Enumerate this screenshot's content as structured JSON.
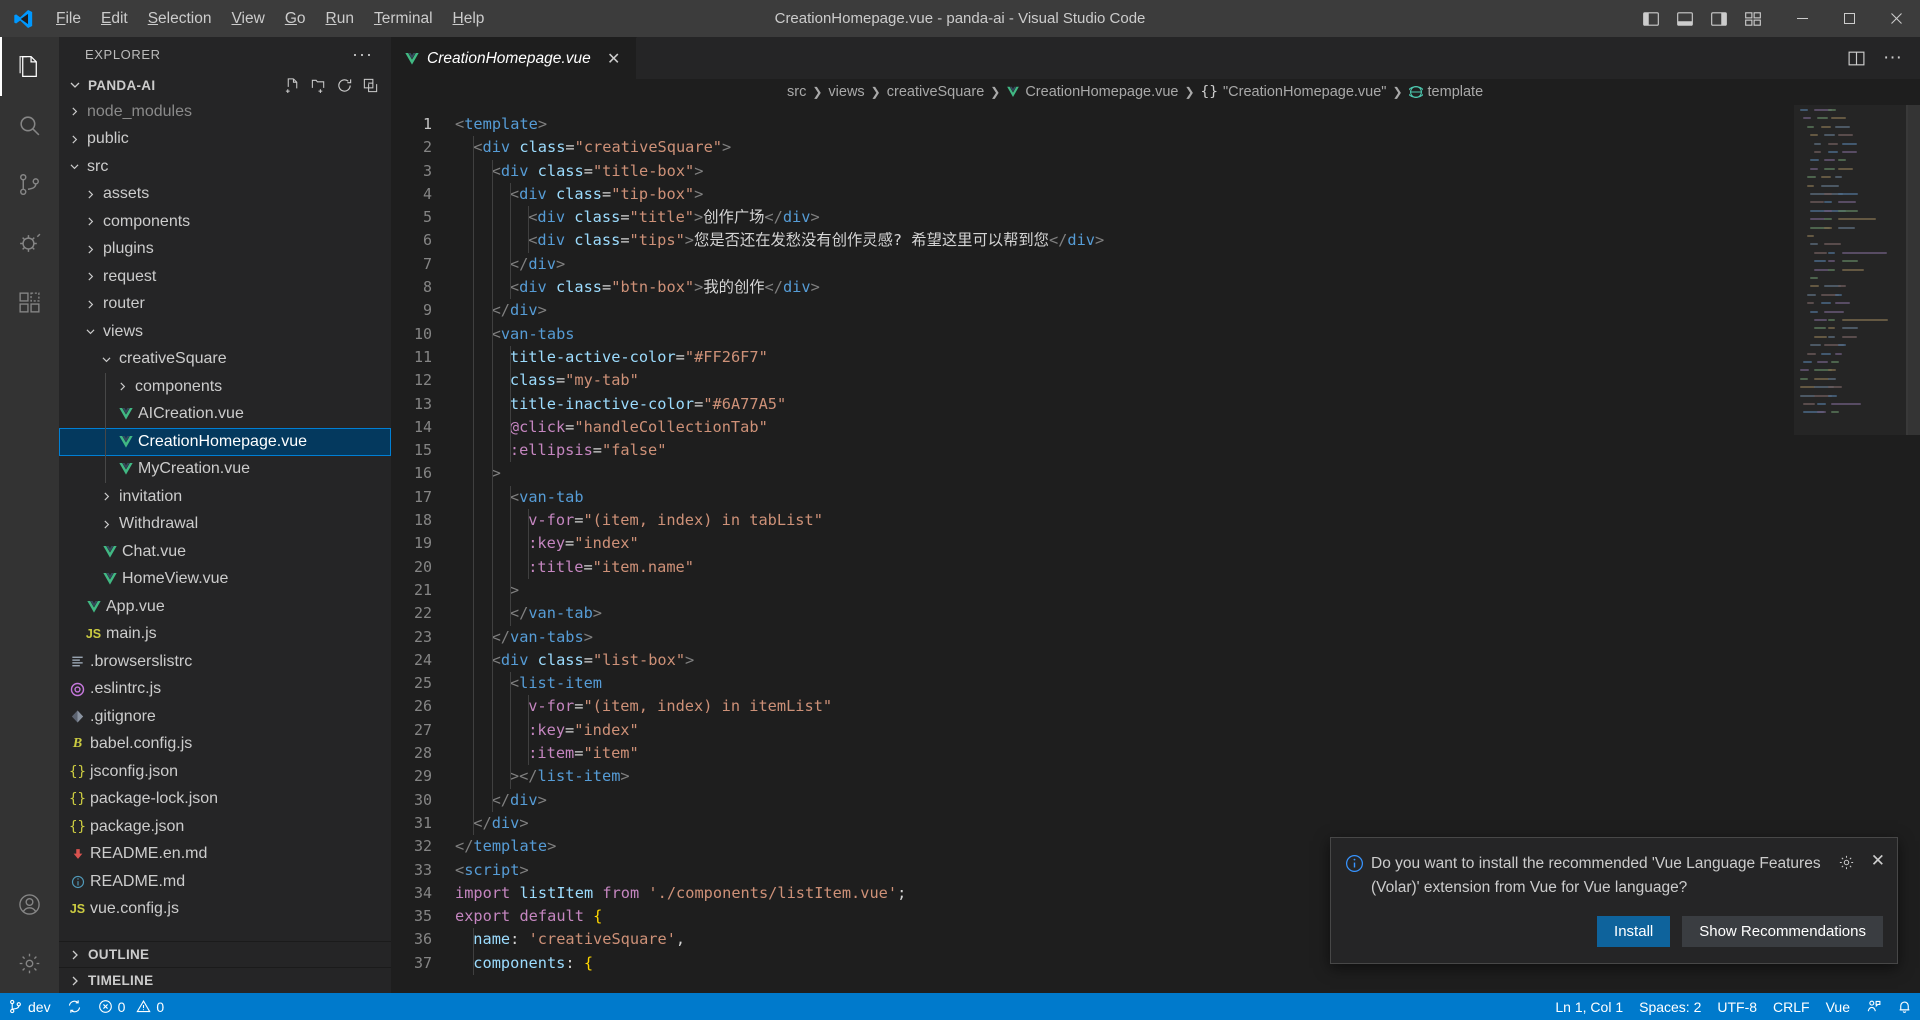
{
  "window": {
    "title": "CreationHomepage.vue - panda-ai - Visual Studio Code",
    "minimize": "─",
    "maximize": "□",
    "close": "✕"
  },
  "menu": {
    "items": [
      {
        "label": "File"
      },
      {
        "label": "Edit"
      },
      {
        "label": "Selection"
      },
      {
        "label": "View"
      },
      {
        "label": "Go"
      },
      {
        "label": "Run"
      },
      {
        "label": "Terminal"
      },
      {
        "label": "Help"
      }
    ]
  },
  "activitybar": {
    "items": [
      {
        "name": "explorer",
        "icon": "files-icon",
        "active": true
      },
      {
        "name": "search",
        "icon": "search-icon",
        "active": false
      },
      {
        "name": "source-control",
        "icon": "source-control-icon",
        "active": false
      },
      {
        "name": "run-debug",
        "icon": "run-and-debug-icon",
        "active": false
      },
      {
        "name": "extensions",
        "icon": "extensions-icon",
        "active": false
      }
    ],
    "bottom": [
      {
        "name": "accounts",
        "icon": "account-icon"
      },
      {
        "name": "settings",
        "icon": "gear-icon"
      }
    ]
  },
  "sidebar": {
    "header_title": "EXPLORER",
    "more_actions": "···",
    "project_name": "PANDA-AI",
    "project_actions": [
      "new-file-icon",
      "new-folder-icon",
      "refresh-icon",
      "collapse-all-icon"
    ],
    "tree": [
      {
        "label": "node_modules",
        "type": "folder",
        "expanded": false,
        "depth": 1,
        "dim": true
      },
      {
        "label": "public",
        "type": "folder",
        "expanded": false,
        "depth": 1
      },
      {
        "label": "src",
        "type": "folder",
        "expanded": true,
        "depth": 1
      },
      {
        "label": "assets",
        "type": "folder",
        "expanded": false,
        "depth": 2
      },
      {
        "label": "components",
        "type": "folder",
        "expanded": false,
        "depth": 2
      },
      {
        "label": "plugins",
        "type": "folder",
        "expanded": false,
        "depth": 2
      },
      {
        "label": "request",
        "type": "folder",
        "expanded": false,
        "depth": 2
      },
      {
        "label": "router",
        "type": "folder",
        "expanded": false,
        "depth": 2
      },
      {
        "label": "views",
        "type": "folder",
        "expanded": true,
        "depth": 2
      },
      {
        "label": "creativeSquare",
        "type": "folder",
        "expanded": true,
        "depth": 3
      },
      {
        "label": "components",
        "type": "folder",
        "expanded": false,
        "depth": 4
      },
      {
        "label": "AICreation.vue",
        "type": "vue",
        "depth": 4
      },
      {
        "label": "CreationHomepage.vue",
        "type": "vue",
        "depth": 4,
        "selected": true
      },
      {
        "label": "MyCreation.vue",
        "type": "vue",
        "depth": 4
      },
      {
        "label": "invitation",
        "type": "folder",
        "expanded": false,
        "depth": 3
      },
      {
        "label": "Withdrawal",
        "type": "folder",
        "expanded": false,
        "depth": 3
      },
      {
        "label": "Chat.vue",
        "type": "vue",
        "depth": 3
      },
      {
        "label": "HomeView.vue",
        "type": "vue",
        "depth": 3
      },
      {
        "label": "App.vue",
        "type": "vue",
        "depth": 2
      },
      {
        "label": "main.js",
        "type": "js",
        "depth": 2
      },
      {
        "label": ".browserslistrc",
        "type": "config",
        "depth": 1
      },
      {
        "label": ".eslintrc.js",
        "type": "eslint",
        "depth": 1
      },
      {
        "label": ".gitignore",
        "type": "git",
        "depth": 1
      },
      {
        "label": "babel.config.js",
        "type": "babel",
        "depth": 1
      },
      {
        "label": "jsconfig.json",
        "type": "json",
        "depth": 1
      },
      {
        "label": "package-lock.json",
        "type": "json",
        "depth": 1
      },
      {
        "label": "package.json",
        "type": "json",
        "depth": 1
      },
      {
        "label": "README.en.md",
        "type": "md-red",
        "depth": 1
      },
      {
        "label": "README.md",
        "type": "md-blue",
        "depth": 1
      },
      {
        "label": "vue.config.js",
        "type": "js",
        "depth": 1
      }
    ],
    "collapsed_sections": [
      {
        "label": "OUTLINE"
      },
      {
        "label": "TIMELINE"
      }
    ]
  },
  "editor": {
    "tab": {
      "name": "CreationHomepage.vue",
      "icon": "vue-icon",
      "close": "✕",
      "modified": false
    },
    "tab_actions": [
      "split-editor-icon",
      "more-actions-icon"
    ],
    "breadcrumb": [
      {
        "label": "src",
        "icon": ""
      },
      {
        "label": "views",
        "icon": ""
      },
      {
        "label": "creativeSquare",
        "icon": ""
      },
      {
        "label": "CreationHomepage.vue",
        "icon": "vue-icon"
      },
      {
        "label": "\"CreationHomepage.vue\"",
        "icon": "json-braces-icon"
      },
      {
        "label": "template",
        "icon": "symbol-module-icon"
      }
    ],
    "first_line": 1,
    "code_lines": [
      {
        "n": 1,
        "indent": 0,
        "tokens": [
          [
            "t-brk",
            "<"
          ],
          [
            "t-tag",
            "template"
          ],
          [
            "t-brk",
            ">"
          ]
        ]
      },
      {
        "n": 2,
        "indent": 1,
        "tokens": [
          [
            "t-brk",
            "<"
          ],
          [
            "t-tag",
            "div"
          ],
          [
            "t-attr",
            " class"
          ],
          [
            "t-punc",
            "="
          ],
          [
            "t-str",
            "\"creativeSquare\""
          ],
          [
            "t-brk",
            ">"
          ]
        ]
      },
      {
        "n": 3,
        "indent": 2,
        "tokens": [
          [
            "t-brk",
            "<"
          ],
          [
            "t-tag",
            "div"
          ],
          [
            "t-attr",
            " class"
          ],
          [
            "t-punc",
            "="
          ],
          [
            "t-str",
            "\"title-box\""
          ],
          [
            "t-brk",
            ">"
          ]
        ]
      },
      {
        "n": 4,
        "indent": 3,
        "tokens": [
          [
            "t-brk",
            "<"
          ],
          [
            "t-tag",
            "div"
          ],
          [
            "t-attr",
            " class"
          ],
          [
            "t-punc",
            "="
          ],
          [
            "t-str",
            "\"tip-box\""
          ],
          [
            "t-brk",
            ">"
          ]
        ]
      },
      {
        "n": 5,
        "indent": 4,
        "tokens": [
          [
            "t-brk",
            "<"
          ],
          [
            "t-tag",
            "div"
          ],
          [
            "t-attr",
            " class"
          ],
          [
            "t-punc",
            "="
          ],
          [
            "t-str",
            "\"title\""
          ],
          [
            "t-brk",
            ">"
          ],
          [
            "t-txt",
            "创作广场"
          ],
          [
            "t-brk",
            "</"
          ],
          [
            "t-tag",
            "div"
          ],
          [
            "t-brk",
            ">"
          ]
        ]
      },
      {
        "n": 6,
        "indent": 4,
        "tokens": [
          [
            "t-brk",
            "<"
          ],
          [
            "t-tag",
            "div"
          ],
          [
            "t-attr",
            " class"
          ],
          [
            "t-punc",
            "="
          ],
          [
            "t-str",
            "\"tips\""
          ],
          [
            "t-brk",
            ">"
          ],
          [
            "t-txt",
            "您是否还在发愁没有创作灵感? 希望这里可以帮到您"
          ],
          [
            "t-brk",
            "</"
          ],
          [
            "t-tag",
            "div"
          ],
          [
            "t-brk",
            ">"
          ]
        ]
      },
      {
        "n": 7,
        "indent": 3,
        "tokens": [
          [
            "t-brk",
            "</"
          ],
          [
            "t-tag",
            "div"
          ],
          [
            "t-brk",
            ">"
          ]
        ]
      },
      {
        "n": 8,
        "indent": 3,
        "tokens": [
          [
            "t-brk",
            "<"
          ],
          [
            "t-tag",
            "div"
          ],
          [
            "t-attr",
            " class"
          ],
          [
            "t-punc",
            "="
          ],
          [
            "t-str",
            "\"btn-box\""
          ],
          [
            "t-brk",
            ">"
          ],
          [
            "t-txt",
            "我的创作"
          ],
          [
            "t-brk",
            "</"
          ],
          [
            "t-tag",
            "div"
          ],
          [
            "t-brk",
            ">"
          ]
        ]
      },
      {
        "n": 9,
        "indent": 2,
        "tokens": [
          [
            "t-brk",
            "</"
          ],
          [
            "t-tag",
            "div"
          ],
          [
            "t-brk",
            ">"
          ]
        ]
      },
      {
        "n": 10,
        "indent": 2,
        "tokens": [
          [
            "t-brk",
            "<"
          ],
          [
            "t-tag",
            "van-tabs"
          ]
        ]
      },
      {
        "n": 11,
        "indent": 3,
        "tokens": [
          [
            "t-attr",
            "title-active-color"
          ],
          [
            "t-punc",
            "="
          ],
          [
            "t-str",
            "\"#FF26F7\""
          ]
        ]
      },
      {
        "n": 12,
        "indent": 3,
        "tokens": [
          [
            "t-attr",
            "class"
          ],
          [
            "t-punc",
            "="
          ],
          [
            "t-str",
            "\"my-tab\""
          ]
        ]
      },
      {
        "n": 13,
        "indent": 3,
        "tokens": [
          [
            "t-attr",
            "title-inactive-color"
          ],
          [
            "t-punc",
            "="
          ],
          [
            "t-str",
            "\"#6A77A5\""
          ]
        ]
      },
      {
        "n": 14,
        "indent": 3,
        "tokens": [
          [
            "t-kw",
            "@click"
          ],
          [
            "t-punc",
            "="
          ],
          [
            "t-str",
            "\"handleCollectionTab\""
          ]
        ]
      },
      {
        "n": 15,
        "indent": 3,
        "tokens": [
          [
            "t-kw",
            ":ellipsis"
          ],
          [
            "t-punc",
            "="
          ],
          [
            "t-str",
            "\"false\""
          ]
        ]
      },
      {
        "n": 16,
        "indent": 2,
        "tokens": [
          [
            "t-brk",
            ">"
          ]
        ]
      },
      {
        "n": 17,
        "indent": 3,
        "tokens": [
          [
            "t-brk",
            "<"
          ],
          [
            "t-tag",
            "van-tab"
          ]
        ]
      },
      {
        "n": 18,
        "indent": 4,
        "tokens": [
          [
            "t-kw",
            "v-for"
          ],
          [
            "t-punc",
            "="
          ],
          [
            "t-str",
            "\"(item, index) in tabList\""
          ]
        ]
      },
      {
        "n": 19,
        "indent": 4,
        "tokens": [
          [
            "t-kw",
            ":key"
          ],
          [
            "t-punc",
            "="
          ],
          [
            "t-str",
            "\"index\""
          ]
        ]
      },
      {
        "n": 20,
        "indent": 4,
        "tokens": [
          [
            "t-kw",
            ":title"
          ],
          [
            "t-punc",
            "="
          ],
          [
            "t-str",
            "\"item.name\""
          ]
        ]
      },
      {
        "n": 21,
        "indent": 3,
        "tokens": [
          [
            "t-brk",
            ">"
          ]
        ]
      },
      {
        "n": 22,
        "indent": 3,
        "tokens": [
          [
            "t-brk",
            "</"
          ],
          [
            "t-tag",
            "van-tab"
          ],
          [
            "t-brk",
            ">"
          ]
        ]
      },
      {
        "n": 23,
        "indent": 2,
        "tokens": [
          [
            "t-brk",
            "</"
          ],
          [
            "t-tag",
            "van-tabs"
          ],
          [
            "t-brk",
            ">"
          ]
        ]
      },
      {
        "n": 24,
        "indent": 2,
        "tokens": [
          [
            "t-brk",
            "<"
          ],
          [
            "t-tag",
            "div"
          ],
          [
            "t-attr",
            " class"
          ],
          [
            "t-punc",
            "="
          ],
          [
            "t-str",
            "\"list-box\""
          ],
          [
            "t-brk",
            ">"
          ]
        ]
      },
      {
        "n": 25,
        "indent": 3,
        "tokens": [
          [
            "t-brk",
            "<"
          ],
          [
            "t-tag",
            "list-item"
          ]
        ]
      },
      {
        "n": 26,
        "indent": 4,
        "tokens": [
          [
            "t-kw",
            "v-for"
          ],
          [
            "t-punc",
            "="
          ],
          [
            "t-str",
            "\"(item, index) in itemList\""
          ]
        ]
      },
      {
        "n": 27,
        "indent": 4,
        "tokens": [
          [
            "t-kw",
            ":key"
          ],
          [
            "t-punc",
            "="
          ],
          [
            "t-str",
            "\"index\""
          ]
        ]
      },
      {
        "n": 28,
        "indent": 4,
        "tokens": [
          [
            "t-kw",
            ":item"
          ],
          [
            "t-punc",
            "="
          ],
          [
            "t-str",
            "\"item\""
          ]
        ]
      },
      {
        "n": 29,
        "indent": 3,
        "tokens": [
          [
            "t-brk",
            "></"
          ],
          [
            "t-tag",
            "list-item"
          ],
          [
            "t-brk",
            ">"
          ]
        ]
      },
      {
        "n": 30,
        "indent": 2,
        "tokens": [
          [
            "t-brk",
            "</"
          ],
          [
            "t-tag",
            "div"
          ],
          [
            "t-brk",
            ">"
          ]
        ]
      },
      {
        "n": 31,
        "indent": 1,
        "tokens": [
          [
            "t-brk",
            "</"
          ],
          [
            "t-tag",
            "div"
          ],
          [
            "t-brk",
            ">"
          ]
        ]
      },
      {
        "n": 32,
        "indent": 0,
        "tokens": [
          [
            "t-brk",
            "</"
          ],
          [
            "t-tag",
            "template"
          ],
          [
            "t-brk",
            ">"
          ]
        ]
      },
      {
        "n": 33,
        "indent": 0,
        "tokens": [
          [
            "t-brk",
            "<"
          ],
          [
            "t-tag",
            "script"
          ],
          [
            "t-brk",
            ">"
          ]
        ]
      },
      {
        "n": 34,
        "indent": 0,
        "tokens": [
          [
            "t-kw",
            "import"
          ],
          [
            "t-var",
            " listItem"
          ],
          [
            "t-kw",
            " from"
          ],
          [
            "t-str",
            " './components/listItem.vue'"
          ],
          [
            "t-punc",
            ";"
          ]
        ]
      },
      {
        "n": 35,
        "indent": 0,
        "tokens": [
          [
            "t-kw",
            "export"
          ],
          [
            "t-kw",
            " default"
          ],
          [
            "t-brace1",
            " {"
          ]
        ]
      },
      {
        "n": 36,
        "indent": 1,
        "tokens": [
          [
            "t-prop",
            "name"
          ],
          [
            "t-punc",
            ": "
          ],
          [
            "t-str",
            "'creativeSquare'"
          ],
          [
            "t-punc",
            ","
          ]
        ]
      },
      {
        "n": 37,
        "indent": 1,
        "tokens": [
          [
            "t-prop",
            "components"
          ],
          [
            "t-punc",
            ": "
          ],
          [
            "t-brace1",
            "{"
          ]
        ]
      }
    ]
  },
  "notification": {
    "icon": "info-icon",
    "message": "Do you want to install the recommended 'Vue Language Features (Volar)' extension from Vue for Vue language?",
    "gear": "gear-icon",
    "close": "✕",
    "primary_button": "Install",
    "secondary_button": "Show Recommendations"
  },
  "statusbar": {
    "branch": "dev",
    "sync_icon": "sync-icon",
    "errors": "0",
    "warnings": "0",
    "cursor_position": "Ln 1, Col 1",
    "indentation": "Spaces: 2",
    "encoding": "UTF-8",
    "eol": "CRLF",
    "language": "Vue",
    "feedback_icon": "feedback-icon",
    "bell_icon": "bell-icon"
  },
  "colors": {
    "accent": "#007acc",
    "selection": "#04395e",
    "selection_border": "#007fd4",
    "titlebar": "#3c3c3c",
    "sidebar": "#252526",
    "editor": "#1e1e1e",
    "activitybar": "#333333",
    "button_primary": "#0e639c",
    "button_secondary": "#3a3d41",
    "vue_green": "#41b883"
  }
}
